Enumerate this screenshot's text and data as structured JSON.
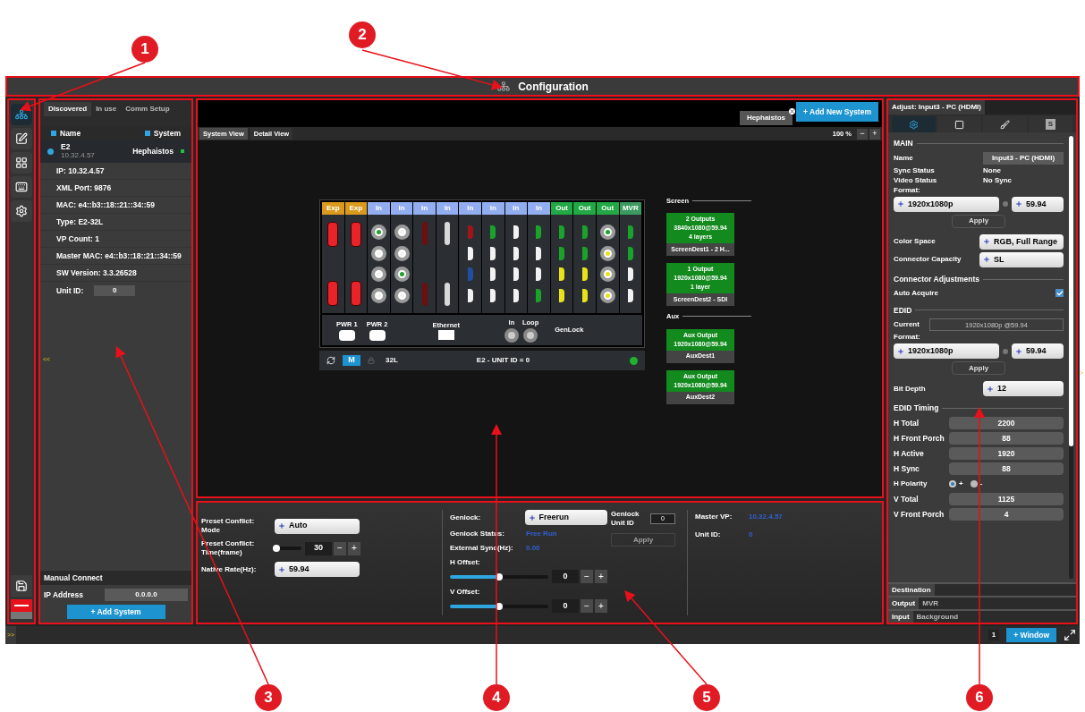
{
  "callouts": [
    "1",
    "2",
    "3",
    "4",
    "5",
    "6"
  ],
  "window": {
    "title": "Configuration"
  },
  "sidebar": {
    "items": [
      {
        "kind": "network",
        "selected": true
      },
      {
        "kind": "edit",
        "selected": false
      },
      {
        "kind": "grid",
        "selected": false
      },
      {
        "kind": "keyboard",
        "selected": false
      },
      {
        "kind": "gear",
        "selected": false
      }
    ]
  },
  "system_panel": {
    "tabs": [
      {
        "label": "Discovered",
        "selected": true
      },
      {
        "label": "In use",
        "selected": false
      },
      {
        "label": "Comm Setup",
        "selected": false
      }
    ],
    "columns": [
      "Name",
      "System"
    ],
    "system": {
      "name": "E2",
      "address": "10.32.4.57",
      "system": "Hephaistos",
      "online": true,
      "selected": true
    },
    "details": [
      "IP: 10.32.4.57",
      "XML Port: 9876",
      "MAC: e4::b3::18::21::34::59",
      "Type: E2-32L",
      "VP Count: 1",
      "Master MAC: e4::b3::18::21::34::59",
      "SW Version: 3.3.26528"
    ],
    "unit_id": {
      "label": "Unit ID:",
      "value": "0"
    },
    "collapse": "<<",
    "manual_connect": {
      "title": "Manual Connect",
      "ip_label": "IP Address",
      "ip_value": "0.0.0.0",
      "button": "+ Add System"
    }
  },
  "canvas": {
    "system_tabs": [
      {
        "label": "Hephaistos"
      }
    ],
    "add_button": "+ Add New System",
    "view_tabs": [
      {
        "label": "System View",
        "selected": true
      },
      {
        "label": "Detail View",
        "selected": false
      }
    ],
    "zoom": "100 %",
    "zoom_out": "−",
    "zoom_in": "+",
    "device": {
      "slots": [
        {
          "label": "Exp",
          "kind": "exp",
          "ports": [
            {
              "kind": "card",
              "color": "#e8242a"
            },
            {
              "kind": "card",
              "color": "#e8242a"
            }
          ]
        },
        {
          "label": "Exp",
          "kind": "exp",
          "ports": [
            {
              "kind": "card",
              "color": "#e8242a"
            },
            {
              "kind": "card",
              "color": "#e8242a"
            }
          ]
        },
        {
          "label": "In",
          "kind": "in",
          "ports": [
            {
              "kind": "bnc",
              "color": "#1aa32a"
            },
            {
              "kind": "bnc",
              "color": "#f2f2f2"
            },
            {
              "kind": "bnc",
              "color": "#f2f2f2"
            },
            {
              "kind": "bnc",
              "color": "#f2f2f2"
            }
          ]
        },
        {
          "label": "In",
          "kind": "in",
          "ports": [
            {
              "kind": "bnc",
              "color": "#f2f2f2"
            },
            {
              "kind": "bnc",
              "color": "#f2f2f2"
            },
            {
              "kind": "bnc",
              "color": "#1aa32a"
            },
            {
              "kind": "bnc",
              "color": "#f2f2f2"
            }
          ]
        },
        {
          "label": "In",
          "kind": "in",
          "ports": [
            {
              "kind": "dvi",
              "color": "#6b0f0f"
            },
            {
              "kind": "dvi",
              "color": "#6b0f0f"
            }
          ]
        },
        {
          "label": "In",
          "kind": "in",
          "ports": [
            {
              "kind": "dvi",
              "color": "#d8d8d8"
            },
            {
              "kind": "dvi",
              "color": "#d8d8d8"
            }
          ]
        },
        {
          "label": "In",
          "kind": "in",
          "ports": [
            {
              "kind": "hdmi",
              "color": "#a3141a"
            },
            {
              "kind": "hdmi",
              "color": "#f2f2f2"
            },
            {
              "kind": "hdmi",
              "color": "#1f4fa0"
            },
            {
              "kind": "hdmi",
              "color": "#f2f2f2"
            }
          ]
        },
        {
          "label": "In",
          "kind": "in",
          "ports": [
            {
              "kind": "hdmi",
              "color": "#1aa32a"
            },
            {
              "kind": "hdmi",
              "color": "#f2f2f2"
            },
            {
              "kind": "hdmi",
              "color": "#f2f2f2"
            },
            {
              "kind": "hdmi",
              "color": "#f2f2f2"
            }
          ]
        },
        {
          "label": "In",
          "kind": "in",
          "ports": [
            {
              "kind": "hdmi",
              "color": "#f2f2f2"
            },
            {
              "kind": "hdmi",
              "color": "#f2f2f2"
            },
            {
              "kind": "hdmi",
              "color": "#f2f2f2"
            },
            {
              "kind": "hdmi",
              "color": "#f2f2f2"
            }
          ]
        },
        {
          "label": "In",
          "kind": "in",
          "ports": [
            {
              "kind": "hdmi",
              "color": "#1aa32a"
            },
            {
              "kind": "hdmi",
              "color": "#f2f2f2"
            },
            {
              "kind": "hdmi",
              "color": "#f2f2f2"
            },
            {
              "kind": "hdmi",
              "color": "#1aa32a"
            }
          ]
        },
        {
          "label": "Out",
          "kind": "out",
          "ports": [
            {
              "kind": "hdmi",
              "color": "#1aa32a"
            },
            {
              "kind": "hdmi",
              "color": "#1aa32a"
            },
            {
              "kind": "hdmi",
              "color": "#e8e21a"
            },
            {
              "kind": "hdmi",
              "color": "#e8e21a"
            }
          ]
        },
        {
          "label": "Out",
          "kind": "out",
          "ports": [
            {
              "kind": "hdmi",
              "color": "#1aa32a"
            },
            {
              "kind": "hdmi",
              "color": "#1aa32a"
            },
            {
              "kind": "hdmi",
              "color": "#e8e21a"
            },
            {
              "kind": "hdmi",
              "color": "#e8e21a"
            }
          ]
        },
        {
          "label": "Out",
          "kind": "out",
          "ports": [
            {
              "kind": "bnc",
              "color": "#1aa32a"
            },
            {
              "kind": "bnc",
              "color": "#e8e21a"
            },
            {
              "kind": "bnc",
              "color": "#e8e21a"
            },
            {
              "kind": "bnc",
              "color": "#e8e21a"
            }
          ]
        },
        {
          "label": "MVR",
          "kind": "mvr",
          "ports": [
            {
              "kind": "hdmi",
              "color": "#1aa32a"
            },
            {
              "kind": "hdmi",
              "color": "#1aa32a"
            },
            {
              "kind": "hdmi",
              "color": "#f2f2f2"
            },
            {
              "kind": "hdmi",
              "color": "#f2f2f2"
            }
          ]
        }
      ],
      "rear": {
        "power": [
          "PWR 1",
          "PWR 2"
        ],
        "ethernet": "Ethernet",
        "genlock_ports": [
          "In",
          "Loop"
        ],
        "genlock": "GenLock"
      },
      "footer": {
        "mode": "M",
        "model": "32L",
        "title": "E2 - UNIT ID = 0",
        "online": true
      }
    },
    "destinations": [
      {
        "section": "Screen",
        "items": [
          {
            "lines": [
              "2 Outputs",
              "3840x1080@59.94",
              "4 layers"
            ],
            "name": "ScreenDest1 - 2 H..."
          },
          {
            "lines": [
              "1 Output",
              "1920x1080@59.94",
              "1 layer"
            ],
            "name": "ScreenDest2 - SDI"
          }
        ]
      },
      {
        "section": "Aux",
        "items": [
          {
            "lines": [
              "Aux Output",
              "1920x1080@59.94"
            ],
            "name": "AuxDest1"
          },
          {
            "lines": [
              "Aux Output",
              "1920x1080@59.94"
            ],
            "name": "AuxDest2"
          }
        ]
      }
    ]
  },
  "settings": {
    "preset_mode": {
      "label": "Preset Conflict: Mode",
      "value": "Auto"
    },
    "preset_time": {
      "label": "Preset Conflict: Time(frame)",
      "level": 0.05,
      "value": "30"
    },
    "native_rate": {
      "label": "Native Rate(Hz):",
      "value": "59.94"
    },
    "genlock": {
      "label": "Genlock:",
      "value": "Freerun"
    },
    "genlock_status": {
      "label": "Genlock Status:",
      "value": "Free Run"
    },
    "external_sync": {
      "label": "External Sync(Hz):",
      "value": "0.00"
    },
    "h_offset": {
      "label": "H Offset:",
      "level": 0.5,
      "value": "0"
    },
    "v_offset": {
      "label": "V Offset:",
      "level": 0.5,
      "value": "0"
    },
    "genlock_unit": {
      "label": "Genlock Unit ID",
      "value": "0",
      "button": "Apply",
      "disabled": true
    },
    "master_vp": {
      "label": "Master VP:",
      "value": "10.32.4.57"
    },
    "unit_id": {
      "label": "Unit ID:",
      "value": "0"
    },
    "minus": "−",
    "plus": "+"
  },
  "adjust": {
    "tab": "Adjust: Input3 - PC (HDMI)",
    "icon_tabs": [
      {
        "kind": "gear",
        "selected": true
      },
      {
        "kind": "frame",
        "selected": false
      },
      {
        "kind": "brush",
        "selected": false
      },
      {
        "kind": "letter",
        "label": "S",
        "selected": false
      }
    ],
    "main": "MAIN",
    "name": {
      "label": "Name",
      "value": "Input3 - PC (HDMI)"
    },
    "sync_status": {
      "label": "Sync Status",
      "value": "None"
    },
    "video_status": {
      "label": "Video Status",
      "value": "No Sync"
    },
    "format": {
      "label": "Format:",
      "value": "1920x1080p",
      "rate": "59.94"
    },
    "apply": "Apply",
    "color_space": {
      "label": "Color Space",
      "value": "RGB, Full Range"
    },
    "capacity": {
      "label": "Connector Capacity",
      "value": "SL"
    },
    "connector_adjustments": "Connector Adjustments",
    "auto_acquire": {
      "label": "Auto Acquire",
      "checked": true
    },
    "edid": "EDID",
    "current": {
      "label": "Current",
      "value": "1920x1080p @59.94"
    },
    "edid_format": {
      "label": "Format:",
      "value": "1920x1080p",
      "rate": "59.94"
    },
    "edid_apply": "Apply",
    "bit_depth": {
      "label": "Bit Depth",
      "value": "12"
    },
    "timing": "EDID Timing",
    "h_rows": [
      {
        "label": "H Total",
        "value": "2200"
      },
      {
        "label": "H Front Porch",
        "value": "88"
      },
      {
        "label": "H Active",
        "value": "1920"
      },
      {
        "label": "H Sync",
        "value": "88"
      }
    ],
    "h_polarity": {
      "label": "H Polarity",
      "options": [
        {
          "label": "+",
          "selected": true
        },
        {
          "label": "-",
          "selected": false
        }
      ]
    },
    "v_rows": [
      {
        "label": "V Total",
        "value": "1125"
      },
      {
        "label": "V Front Porch",
        "value": "4"
      }
    ],
    "docks": [
      [
        {
          "label": "Destination",
          "selected": true
        }
      ],
      [
        {
          "label": "Output",
          "selected": true
        },
        {
          "label": "MVR",
          "selected": false
        }
      ],
      [
        {
          "label": "Input",
          "selected": true
        },
        {
          "label": "Background",
          "selected": false
        }
      ]
    ],
    "collapse": ">"
  },
  "status_bar": {
    "expand": ">>",
    "page": "1",
    "button": "+ Window"
  }
}
